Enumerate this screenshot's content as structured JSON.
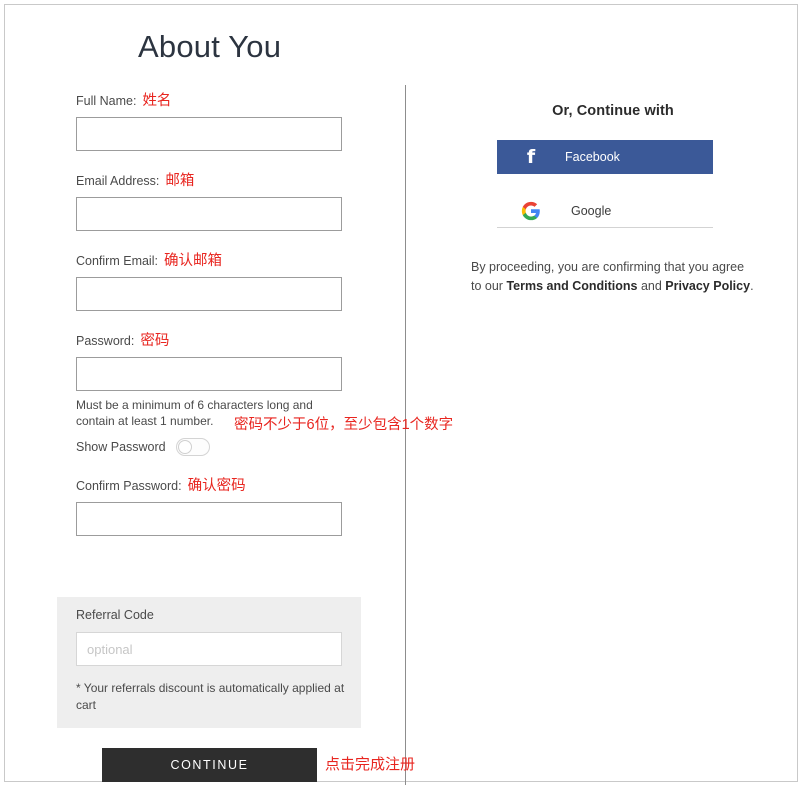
{
  "page": {
    "title": "About You"
  },
  "form": {
    "fields": [
      {
        "label": "Full Name:",
        "zh": "姓名",
        "value": "",
        "placeholder": "",
        "name": "full-name"
      },
      {
        "label": "Email Address:",
        "zh": "邮箱",
        "value": "",
        "placeholder": "",
        "name": "email-address"
      },
      {
        "label": "Confirm Email:",
        "zh": "确认邮箱",
        "value": "",
        "placeholder": "",
        "name": "confirm-email"
      },
      {
        "label": "Password:",
        "zh": "密码",
        "value": "",
        "placeholder": "",
        "name": "password"
      },
      {
        "label": "Confirm Password:",
        "zh": "确认密码",
        "value": "",
        "placeholder": "",
        "name": "confirm-password"
      }
    ],
    "password_hint": "Must be a minimum of 6 characters long and contain at least 1 number.",
    "password_hint_zh": "密码不少于6位，至少包含1个数字",
    "show_password_label": "Show Password",
    "show_password_state": "off"
  },
  "referral": {
    "label": "Referral Code",
    "value": "",
    "placeholder": "optional",
    "note": "* Your referrals discount is automatically applied at cart"
  },
  "actions": {
    "continue_label": "CONTINUE",
    "continue_zh": "点击完成注册"
  },
  "social": {
    "heading": "Or, Continue with",
    "facebook_label": "Facebook",
    "facebook_icon": "f",
    "facebook_color": "#3b5998",
    "google_label": "Google",
    "google_icon": "google-g-logo",
    "terms_prefix": "By proceeding, you are confirming that you agree to our ",
    "terms_link": "Terms and Conditions",
    "terms_middle": " and ",
    "privacy_link": "Privacy Policy",
    "terms_suffix": "."
  },
  "colors": {
    "annotation_red": "#e8251f",
    "button_dark": "#2e2e2e",
    "panel_gray": "#eeeeee"
  }
}
